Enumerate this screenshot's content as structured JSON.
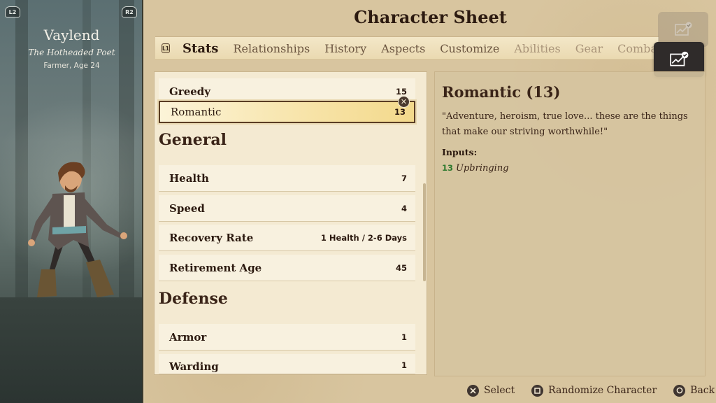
{
  "character": {
    "name": "Vaylend",
    "title": "The Hotheaded Poet",
    "subtitle": "Farmer, Age 24",
    "shoulder_left": "L2",
    "shoulder_right": "R2"
  },
  "header": {
    "title": "Character Sheet"
  },
  "tabs": {
    "bumper": "L1",
    "items": [
      {
        "label": "Stats",
        "state": "active"
      },
      {
        "label": "Relationships",
        "state": "normal"
      },
      {
        "label": "History",
        "state": "normal"
      },
      {
        "label": "Aspects",
        "state": "normal"
      },
      {
        "label": "Customize",
        "state": "normal"
      },
      {
        "label": "Abilities",
        "state": "dim"
      },
      {
        "label": "Gear",
        "state": "dim"
      },
      {
        "label": "Comba",
        "state": "dim"
      }
    ]
  },
  "corner_buttons": {
    "icon": "chart-check-icon"
  },
  "stats": {
    "top_rows": [
      {
        "label": "Greedy",
        "value": "15"
      },
      {
        "label": "Romantic",
        "value": "13",
        "selected": true
      }
    ],
    "sections": [
      {
        "title": "General",
        "rows": [
          {
            "label": "Health",
            "value": "7"
          },
          {
            "label": "Speed",
            "value": "4"
          },
          {
            "label": "Recovery Rate",
            "value": "1 Health / 2-6 Days"
          },
          {
            "label": "Retirement Age",
            "value": "45"
          }
        ]
      },
      {
        "title": "Defense",
        "rows": [
          {
            "label": "Armor",
            "value": "1"
          },
          {
            "label": "Warding",
            "value": "1"
          }
        ]
      }
    ]
  },
  "detail": {
    "title": "Romantic (13)",
    "quote": "\"Adventure, heroism, true love... these are the things that make our striving worthwhile!\"",
    "inputs_label": "Inputs:",
    "inputs": [
      {
        "value": "13",
        "label": "Upbringing"
      }
    ]
  },
  "footer": {
    "select": "Select",
    "randomize": "Randomize Character",
    "back": "Back"
  },
  "colors": {
    "input_value": "#2f7a2f",
    "selected_border": "#5a3d24"
  }
}
